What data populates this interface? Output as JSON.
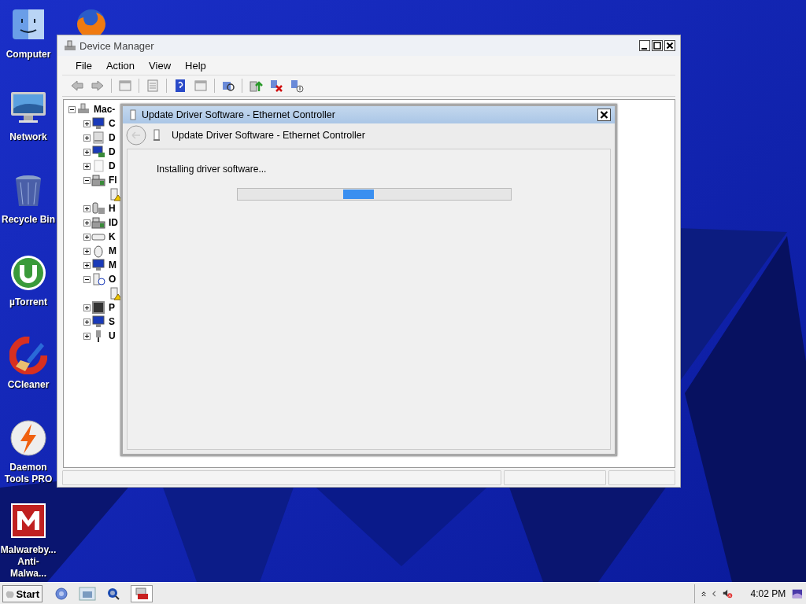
{
  "desktop_icons": [
    {
      "label": "Computer",
      "kind": "finder"
    },
    {
      "label": "Network",
      "kind": "monitor"
    },
    {
      "label": "Recycle Bin",
      "kind": "trash"
    },
    {
      "label": "µTorrent",
      "kind": "torrent"
    },
    {
      "label": "CCleaner",
      "kind": "cleaner"
    },
    {
      "label": "Daemon Tools PRO",
      "kind": "bolt"
    },
    {
      "label": "Malwareby... Anti-Malwa...",
      "kind": "shield"
    }
  ],
  "device_manager": {
    "title": "Device Manager",
    "menu": [
      "File",
      "Action",
      "View",
      "Help"
    ],
    "tree": {
      "label": "Mac-",
      "kind": "computer",
      "expanded": true,
      "children": [
        {
          "label": "C",
          "kind": "monitor",
          "expanded": false
        },
        {
          "label": "D",
          "kind": "drive",
          "expanded": false
        },
        {
          "label": "D",
          "kind": "display",
          "expanded": false
        },
        {
          "label": "D",
          "kind": "blank",
          "expanded": false
        },
        {
          "label": "Fl",
          "kind": "controller",
          "expanded": true,
          "children": [
            {
              "kind": "warning"
            }
          ]
        },
        {
          "label": "H",
          "kind": "hid",
          "expanded": false
        },
        {
          "label": "ID",
          "kind": "controller",
          "expanded": false
        },
        {
          "label": "K",
          "kind": "keyboard",
          "expanded": false
        },
        {
          "label": "M",
          "kind": "mouse",
          "expanded": false
        },
        {
          "label": "M",
          "kind": "monitor",
          "expanded": false
        },
        {
          "label": "O",
          "kind": "question",
          "expanded": true,
          "children": [
            {
              "kind": "warning"
            }
          ]
        },
        {
          "label": "P",
          "kind": "chip",
          "expanded": false
        },
        {
          "label": "S",
          "kind": "monitor",
          "expanded": false
        },
        {
          "label": "U",
          "kind": "usb",
          "expanded": false
        }
      ]
    }
  },
  "dialog": {
    "title": "Update Driver Software - Ethernet Controller",
    "header": "Update Driver Software - Ethernet Controller",
    "message": "Installing driver software..."
  },
  "taskbar": {
    "start": "Start",
    "clock": "4:02 PM"
  }
}
